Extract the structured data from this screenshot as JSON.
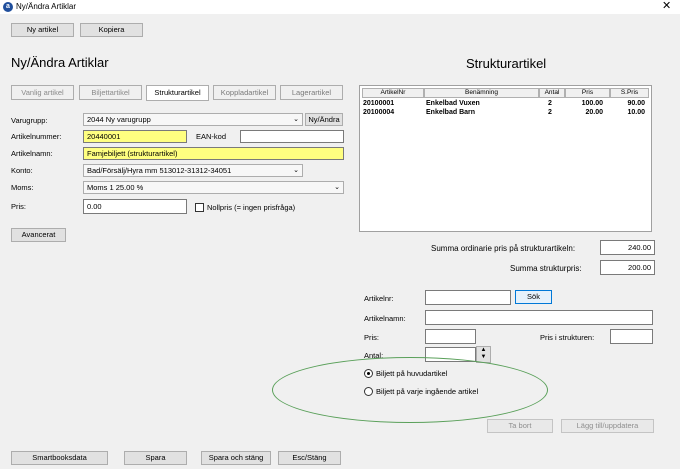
{
  "window": {
    "title": "Ny/Ändra Artiklar",
    "close": "✕"
  },
  "toolbar": {
    "new_article": "Ny artikel",
    "copy": "Kopiera"
  },
  "page_title": "Ny/Ändra Artiklar",
  "tabs": [
    "Vanlig artikel",
    "Biljettartikel",
    "Strukturartikel",
    "Koppladartikel",
    "Lagerartikel"
  ],
  "form": {
    "varugrupp_label": "Varugrupp:",
    "varugrupp_value": "2044 Ny varugrupp",
    "ny_andra": "Ny/Ändra",
    "artikelnummer_label": "Artikelnummer:",
    "artikelnummer_value": "20440001",
    "ean_label": "EAN-kod",
    "ean_value": "",
    "artikelnamn_label": "Artikelnamn:",
    "artikelnamn_value": "Famjebiljett (strukturartikel)",
    "konto_label": "Konto:",
    "konto_value": "Bad/Försälj/Hyra mm 513012-31312-34051",
    "moms_label": "Moms:",
    "moms_value": "Moms 1 25.00 %",
    "pris_label": "Pris:",
    "pris_value": "0.00",
    "nollpris_label": "Nollpris (= ingen prisfråga)",
    "advanced": "Avancerat"
  },
  "structure": {
    "title": "Strukturartikel",
    "columns": [
      "ArtikelNr",
      "Benämning",
      "Antal",
      "Pris",
      "S.Pris"
    ],
    "rows": [
      {
        "nr": "20100001",
        "name": "Enkelbad Vuxen",
        "antal": "2",
        "pris": "100.00",
        "spris": "90.00"
      },
      {
        "nr": "20100004",
        "name": "Enkelbad Barn",
        "antal": "2",
        "pris": "20.00",
        "spris": "10.00"
      }
    ],
    "sum_ordinary_label": "Summa ordinarie pris på strukturartikeln:",
    "sum_ordinary_value": "240.00",
    "sum_structure_label": "Summa strukturpris:",
    "sum_structure_value": "200.00"
  },
  "search": {
    "artikelnr_label": "Artikelnr:",
    "search_button": "Sök",
    "artikelnamn_label": "Artikelnamn:",
    "pris_label": "Pris:",
    "pris_struktur_label": "Pris i strukturen:",
    "antal_label": "Antal:"
  },
  "options": {
    "radio1": "Biljett på huvudartikel",
    "radio2": "Biljett på varje ingående artikel"
  },
  "actions": {
    "delete": "Ta bort",
    "add_update": "Lägg till/uppdatera"
  },
  "footer": {
    "smartbooks": "Smartbooksdata",
    "save": "Spara",
    "save_close": "Spara och stäng",
    "esc": "Esc/Stäng"
  }
}
